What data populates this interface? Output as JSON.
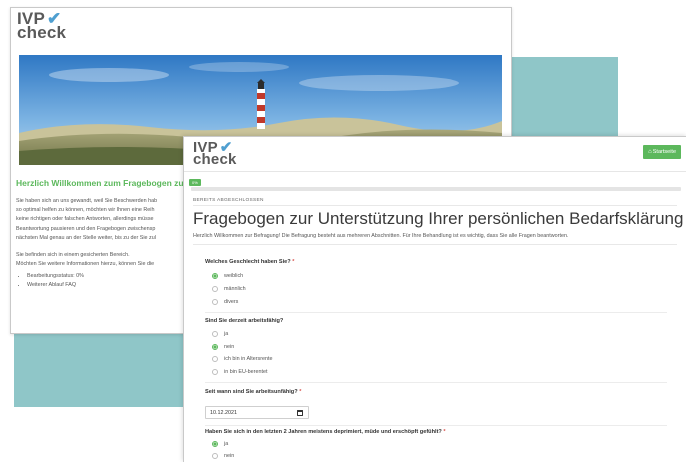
{
  "back_window": {
    "logo_line1": "IVP",
    "logo_line2": "check",
    "heading": "Herzlich Willkommen zum Fragebogen zur",
    "paragraph_lines": [
      "Sie haben sich an uns gewandt, weil Sie Beschwerden hab",
      "so optimal helfen zu können, möchten wir Ihnen eine Reih",
      "keine richtigen oder falschen Antworten, allerdings müsse",
      "Beantwortung pausieren und den Fragebogen zwischensp",
      "nächsten Mal genau an der Stelle weiter, bis zu der Sie zul"
    ],
    "paragraph2_lines": [
      "Sie befinden sich in einem gesicherten Bereich.",
      "Möchten Sie weitere Informationen hierzu, können Sie die"
    ],
    "bullets": [
      "Bearbeitungsstatus: 0%",
      "Weiterer Ablauf FAQ"
    ]
  },
  "front_window": {
    "logo_line1": "IVP",
    "logo_line2": "check",
    "start_button_label": "Startseite",
    "start_button_icon": "home-icon",
    "progress": {
      "value_percent": 0,
      "label": "0%"
    },
    "section_label": "BEREITS ABGESCHLOSSEN",
    "title": "Fragebogen zur Unterstützung Ihrer persönlichen Bedarfsklärung",
    "intro": "Herzlich Willkommen zur Befragung! Die Befragung besteht aus mehreren Abschnitten. Für Ihre Behandlung ist es wichtig, dass Sie alle Fragen beantworten.",
    "questions": [
      {
        "label": "Welches Geschlecht haben Sie?",
        "required_mark": "*",
        "options": [
          {
            "label": "weiblich",
            "checked": true
          },
          {
            "label": "männlich",
            "checked": false
          },
          {
            "label": "divers",
            "checked": false
          }
        ]
      },
      {
        "label": "Sind Sie derzeit arbeitsfähig?",
        "required_mark": "",
        "options": [
          {
            "label": "ja",
            "checked": false
          },
          {
            "label": "nein",
            "checked": true
          },
          {
            "label": "ich bin in Altersrente",
            "checked": false
          },
          {
            "label": "in bin EU-berentet",
            "checked": false
          }
        ]
      },
      {
        "label": "Seit wann sind Sie arbeitsunfähig?",
        "required_mark": "*",
        "date_value": "10.12.2021",
        "date_icon": "calendar-icon"
      },
      {
        "label": "Haben Sie sich in den letzten 2 Jahren meistens deprimiert, müde und erschöpft gefühlt?",
        "required_mark": "*",
        "options": [
          {
            "label": "ja",
            "checked": true
          },
          {
            "label": "nein",
            "checked": false
          }
        ]
      }
    ]
  },
  "colors": {
    "accent_green": "#5cb85c",
    "teal_background": "#8fc6c8",
    "logo_check_blue": "#4f9fd0",
    "required_red": "#d9534f"
  }
}
